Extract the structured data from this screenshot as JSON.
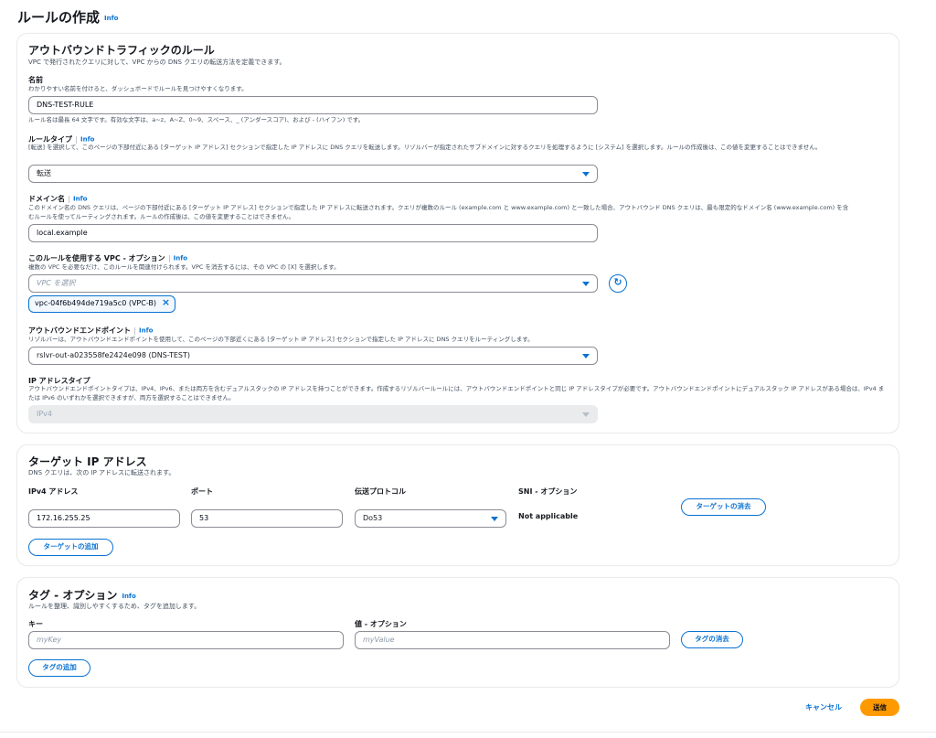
{
  "page": {
    "title": "ルールの作成",
    "info": "Info"
  },
  "outbound": {
    "title": "アウトバウンドトラフィックのルール",
    "description": "VPC で発行されたクエリに対して、VPC からの DNS クエリの転送方法を定義できます。",
    "name": {
      "label": "名前",
      "hint": "わかりやすい名前を付けると、ダッシュボードでルールを見つけやすくなります。",
      "value": "DNS-TEST-RULE",
      "constraint": "ルール名は最長 64 文字です。有効な文字は、a~z、A~Z、0~9、スペース、_ (アンダースコア)、および - (ハイフン) です。"
    },
    "rule_type": {
      "label": "ルールタイプ",
      "info": "Info",
      "hint": "[転送] を選択して、このページの下部付近にある [ターゲット IP アドレス] セクションで指定した IP アドレスに DNS クエリを転送します。リゾルバーが指定されたサブドメインに対するクエリを処理するように [システム] を選択します。ルールの作成後は、この値を変更することはできません。",
      "value": "転送"
    },
    "domain": {
      "label": "ドメイン名",
      "info": "Info",
      "hint": "このドメイン名の DNS クエリは、ページの下部付近にある [ターゲット IP アドレス] セクションで指定した IP アドレスに転送されます。クエリが複数のルール (example.com と www.example.com) と一致した場合、アウトバウンド DNS クエリは、最も限定的なドメイン名 (www.example.com) を含むルールを使ってルーティングされます。ルールの作成後は、この値を変更することはできません。",
      "value": "local.example"
    },
    "vpc": {
      "label": "このルールを使用する VPC - オプション",
      "info": "Info",
      "hint": "複数の VPC を必要なだけ、このルールを関連付けられます。VPC を消去するには、その VPC の [X] を選択します。",
      "placeholder": "VPC を選択",
      "token": "vpc-04f6b494de719a5c0 (VPC-B)"
    },
    "endpoint": {
      "label": "アウトバウンドエンドポイント",
      "info": "Info",
      "hint": "リゾルバーは、アウトバウンドエンドポイントを使用して、このページの下部近くにある [ターゲット IP アドレス] セクションで指定した IP アドレスに DNS クエリをルーティングします。",
      "value": "rslvr-out-a023558fe2424e098 (DNS-TEST)"
    },
    "ip_type": {
      "label": "IP アドレスタイプ",
      "hint": "アウトバウンドエンドポイントタイプは、IPv4、IPv6、または両方を含むデュアルスタックの IP アドレスを持つことができます。作成するリゾルバールールには、アウトバウンドエンドポイントと同じ IP アドレスタイプが必要です。アウトバウンドエンドポイントにデュアルスタック IP アドレスがある場合は、IPv4 または IPv6 のいずれかを選択できますが、両方を選択することはできません。",
      "value": "IPv4"
    }
  },
  "target": {
    "title": "ターゲット IP アドレス",
    "description": "DNS クエリは、次の IP アドレスに転送されます。",
    "columns": {
      "ipv4": "IPv4 アドレス",
      "port": "ポート",
      "protocol": "伝送プロトコル",
      "sni": "SNI - オプション"
    },
    "row": {
      "ipv4": "172.16.255.25",
      "port": "53",
      "protocol": "Do53",
      "sni": "Not applicable"
    },
    "remove_button": "ターゲットの消去",
    "add_button": "ターゲットの追加"
  },
  "tags": {
    "title": "タグ - オプション",
    "info": "Info",
    "description": "ルールを整理、識別しやすくするため、タグを追加します。",
    "key_label": "キー",
    "value_label": "値 - オプション",
    "key_placeholder": "myKey",
    "value_placeholder": "myValue",
    "remove_button": "タグの消去",
    "add_button": "タグの追加"
  },
  "footer": {
    "cancel": "キャンセル",
    "submit": "送信"
  },
  "colors": {
    "accent": "#0972d3",
    "primary": "#ff9900",
    "border": "#8c8c94"
  }
}
